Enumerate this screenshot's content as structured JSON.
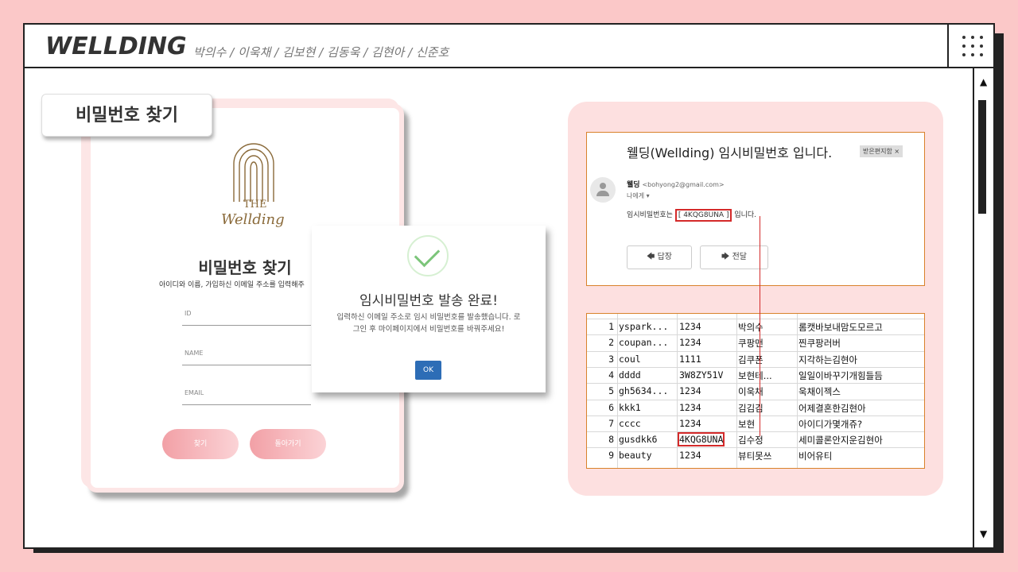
{
  "header": {
    "brand": "WELLDING",
    "members": "박의수 / 이욱채 / 김보현 / 김동욱 / 김현아 / 신준호"
  },
  "tag_label": "비밀번호 찾기",
  "login_card": {
    "logo_the": "THE",
    "logo_name": "Wellding",
    "title": "비밀번호 찾기",
    "subtitle": "아이디와 이름, 가입하신 이메일 주소를 입력해주",
    "fields": [
      "ID",
      "NAME",
      "EMAIL"
    ],
    "find_button": "찾기",
    "back_button": "돌아가기"
  },
  "modal": {
    "title": "임시비밀번호 발송 완료!",
    "body": "입력하신 이메일 주소로 임시 비밀번호를 발송했습니다. 로그인 후 마이페이지에서 비밀번호를 바꿔주세요!",
    "ok_button": "OK"
  },
  "email": {
    "subject": "웰딩(Wellding) 임시비밀번호 입니다.",
    "inbox_chip": "받은편지함 ×",
    "sender_name": "웰딩",
    "sender_email": "<bohyong2@gmail.com>",
    "to_me": "나에게 ▾",
    "text_prefix": "임시비밀번호는 ",
    "password": "[ 4KQG8UNA ]",
    "text_suffix": " 입니다.",
    "reply_button": "답장",
    "forward_button": "전달"
  },
  "db_rows": [
    {
      "idx": "1",
      "id": "yspark...",
      "pw": "1234",
      "name": "박의수",
      "nick": "롬캣바보내맘도모르고"
    },
    {
      "idx": "2",
      "id": "coupan...",
      "pw": "1234",
      "name": "쿠팡맨",
      "nick": "찐쿠팡러버"
    },
    {
      "idx": "3",
      "id": "coul",
      "pw": "1111",
      "name": "김쿠폰",
      "nick": "지각하는김현아"
    },
    {
      "idx": "4",
      "id": "dddd",
      "pw": "3W8ZY51V",
      "name": "보현테...",
      "nick": "일일이바꾸기개힘들듬"
    },
    {
      "idx": "5",
      "id": "gh5634...",
      "pw": "1234",
      "name": "이욱채",
      "nick": "욱채이젝스"
    },
    {
      "idx": "6",
      "id": "kkk1",
      "pw": "1234",
      "name": "김김김",
      "nick": "어제결혼한김현아"
    },
    {
      "idx": "7",
      "id": "cccc",
      "pw": "1234",
      "name": "보현",
      "nick": "아이디가몇개쥬?"
    },
    {
      "idx": "8",
      "id": "gusdkk6",
      "pw": "4KQG8UNA",
      "name": "김수정",
      "nick": "세미콜론안지운김현아"
    },
    {
      "idx": "9",
      "id": "beauty",
      "pw": "1234",
      "name": "뷰티못쓰",
      "nick": "비어유티"
    }
  ],
  "colors": {
    "background": "#fbc8c8",
    "highlight": "#d42a2a",
    "ok_button": "#2d6db6"
  }
}
